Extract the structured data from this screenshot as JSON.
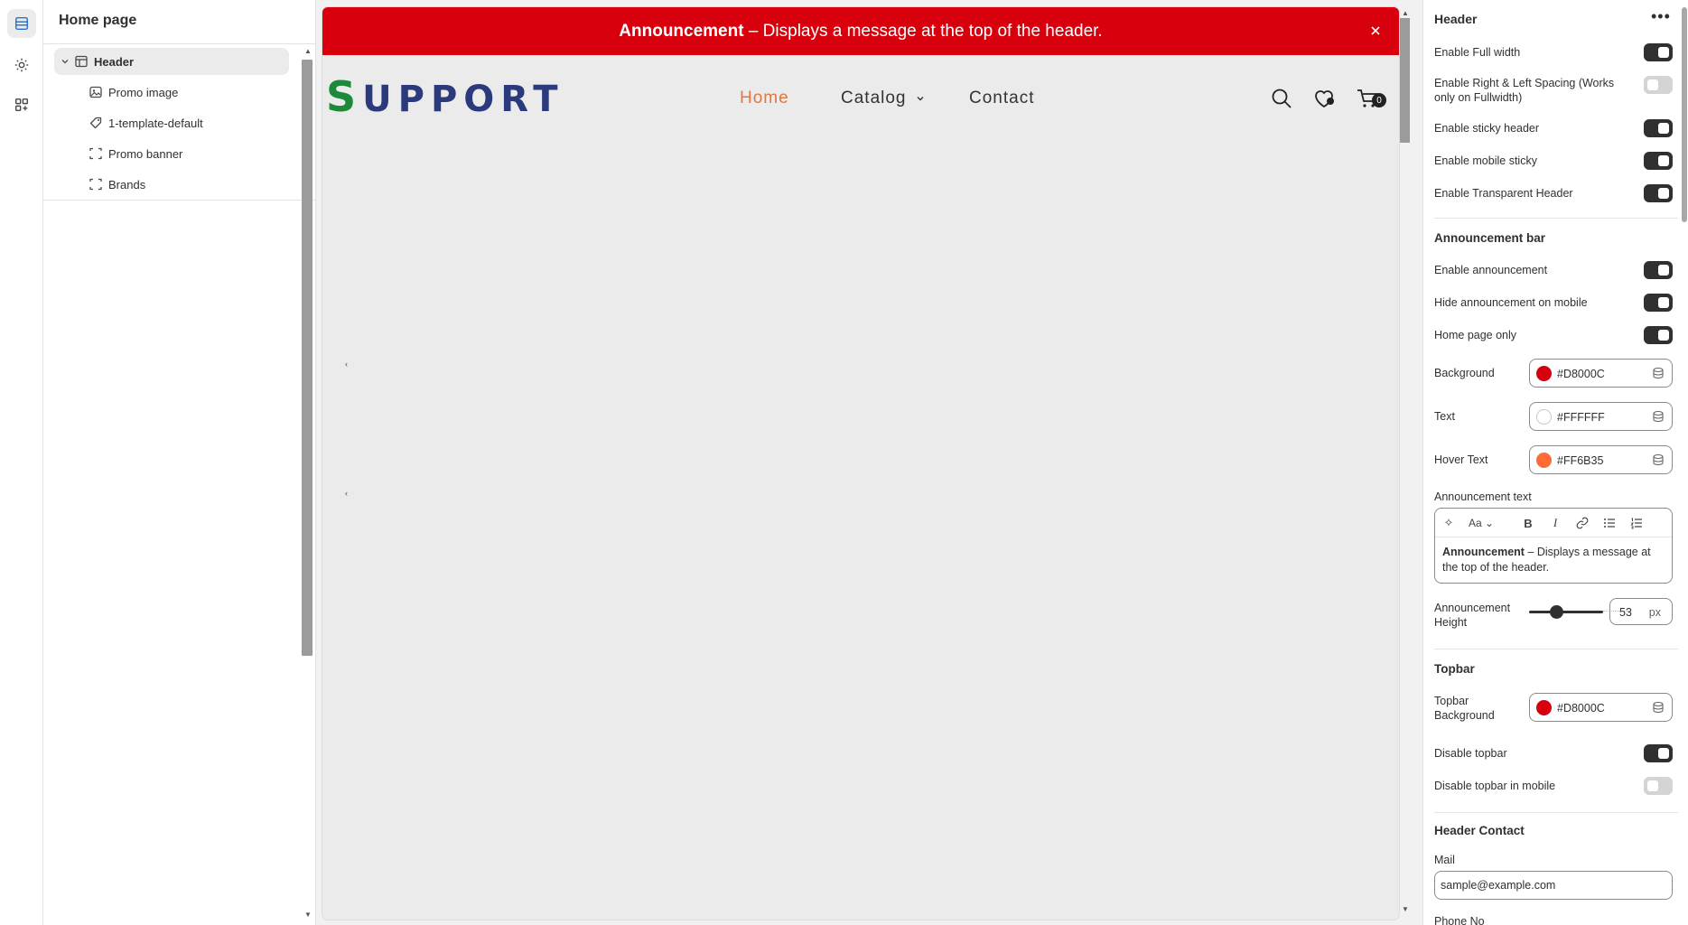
{
  "rail": {
    "icons": [
      "sections-icon",
      "gear-icon",
      "apps-icon"
    ]
  },
  "sidebar": {
    "title": "Home page",
    "items": [
      {
        "label": "Header",
        "icon": "header-layout-icon"
      },
      {
        "label": "Promo image",
        "icon": "image-icon"
      },
      {
        "label": "1-template-default",
        "icon": "tag-icon"
      },
      {
        "label": "Promo banner",
        "icon": "section-frame-icon"
      },
      {
        "label": "Brands",
        "icon": "section-frame-icon"
      }
    ]
  },
  "preview": {
    "announcement": {
      "bold": "Announcement",
      "rest": " – Displays a message at the top of the header."
    },
    "logo": {
      "first": "S",
      "rest": "UPPORT"
    },
    "nav": {
      "home": "Home",
      "catalog": "Catalog",
      "contact": "Contact"
    },
    "cart_count": "0",
    "colors": {
      "announcement_bg": "#D8000C",
      "nav_active": "#E2763F"
    }
  },
  "settings": {
    "title": "Header",
    "more": "•••",
    "header_toggles": [
      {
        "label": "Enable Full width",
        "on": true
      },
      {
        "label": "Enable Right & Left Spacing (Works only on Fullwidth)",
        "on": false
      },
      {
        "label": "Enable sticky header",
        "on": true
      },
      {
        "label": "Enable mobile sticky",
        "on": true
      },
      {
        "label": "Enable Transparent Header",
        "on": true
      }
    ],
    "announcement_bar": {
      "heading": "Announcement bar",
      "toggles": [
        {
          "label": "Enable announcement",
          "on": true
        },
        {
          "label": "Hide announcement on mobile",
          "on": true
        },
        {
          "label": "Home page only",
          "on": true
        }
      ],
      "colors": [
        {
          "label": "Background",
          "hex": "#D8000C"
        },
        {
          "label": "Text",
          "hex": "#FFFFFF"
        },
        {
          "label": "Hover Text",
          "hex": "#FF6B35"
        }
      ],
      "text_label": "Announcement text",
      "text_bold": "Announcement",
      "text_rest": " – Displays a message at the top of the header.",
      "height_label": "Announcement Height",
      "height_value": "53",
      "height_unit": "px"
    },
    "topbar": {
      "heading": "Topbar",
      "bg_label": "Topbar Background",
      "bg_hex": "#D8000C",
      "toggles": [
        {
          "label": "Disable topbar",
          "on": true
        },
        {
          "label": "Disable topbar in mobile",
          "on": false
        }
      ]
    },
    "header_contact": {
      "heading": "Header Contact",
      "mail_label": "Mail",
      "mail_value": "sample@example.com",
      "phone_label": "Phone No"
    }
  }
}
